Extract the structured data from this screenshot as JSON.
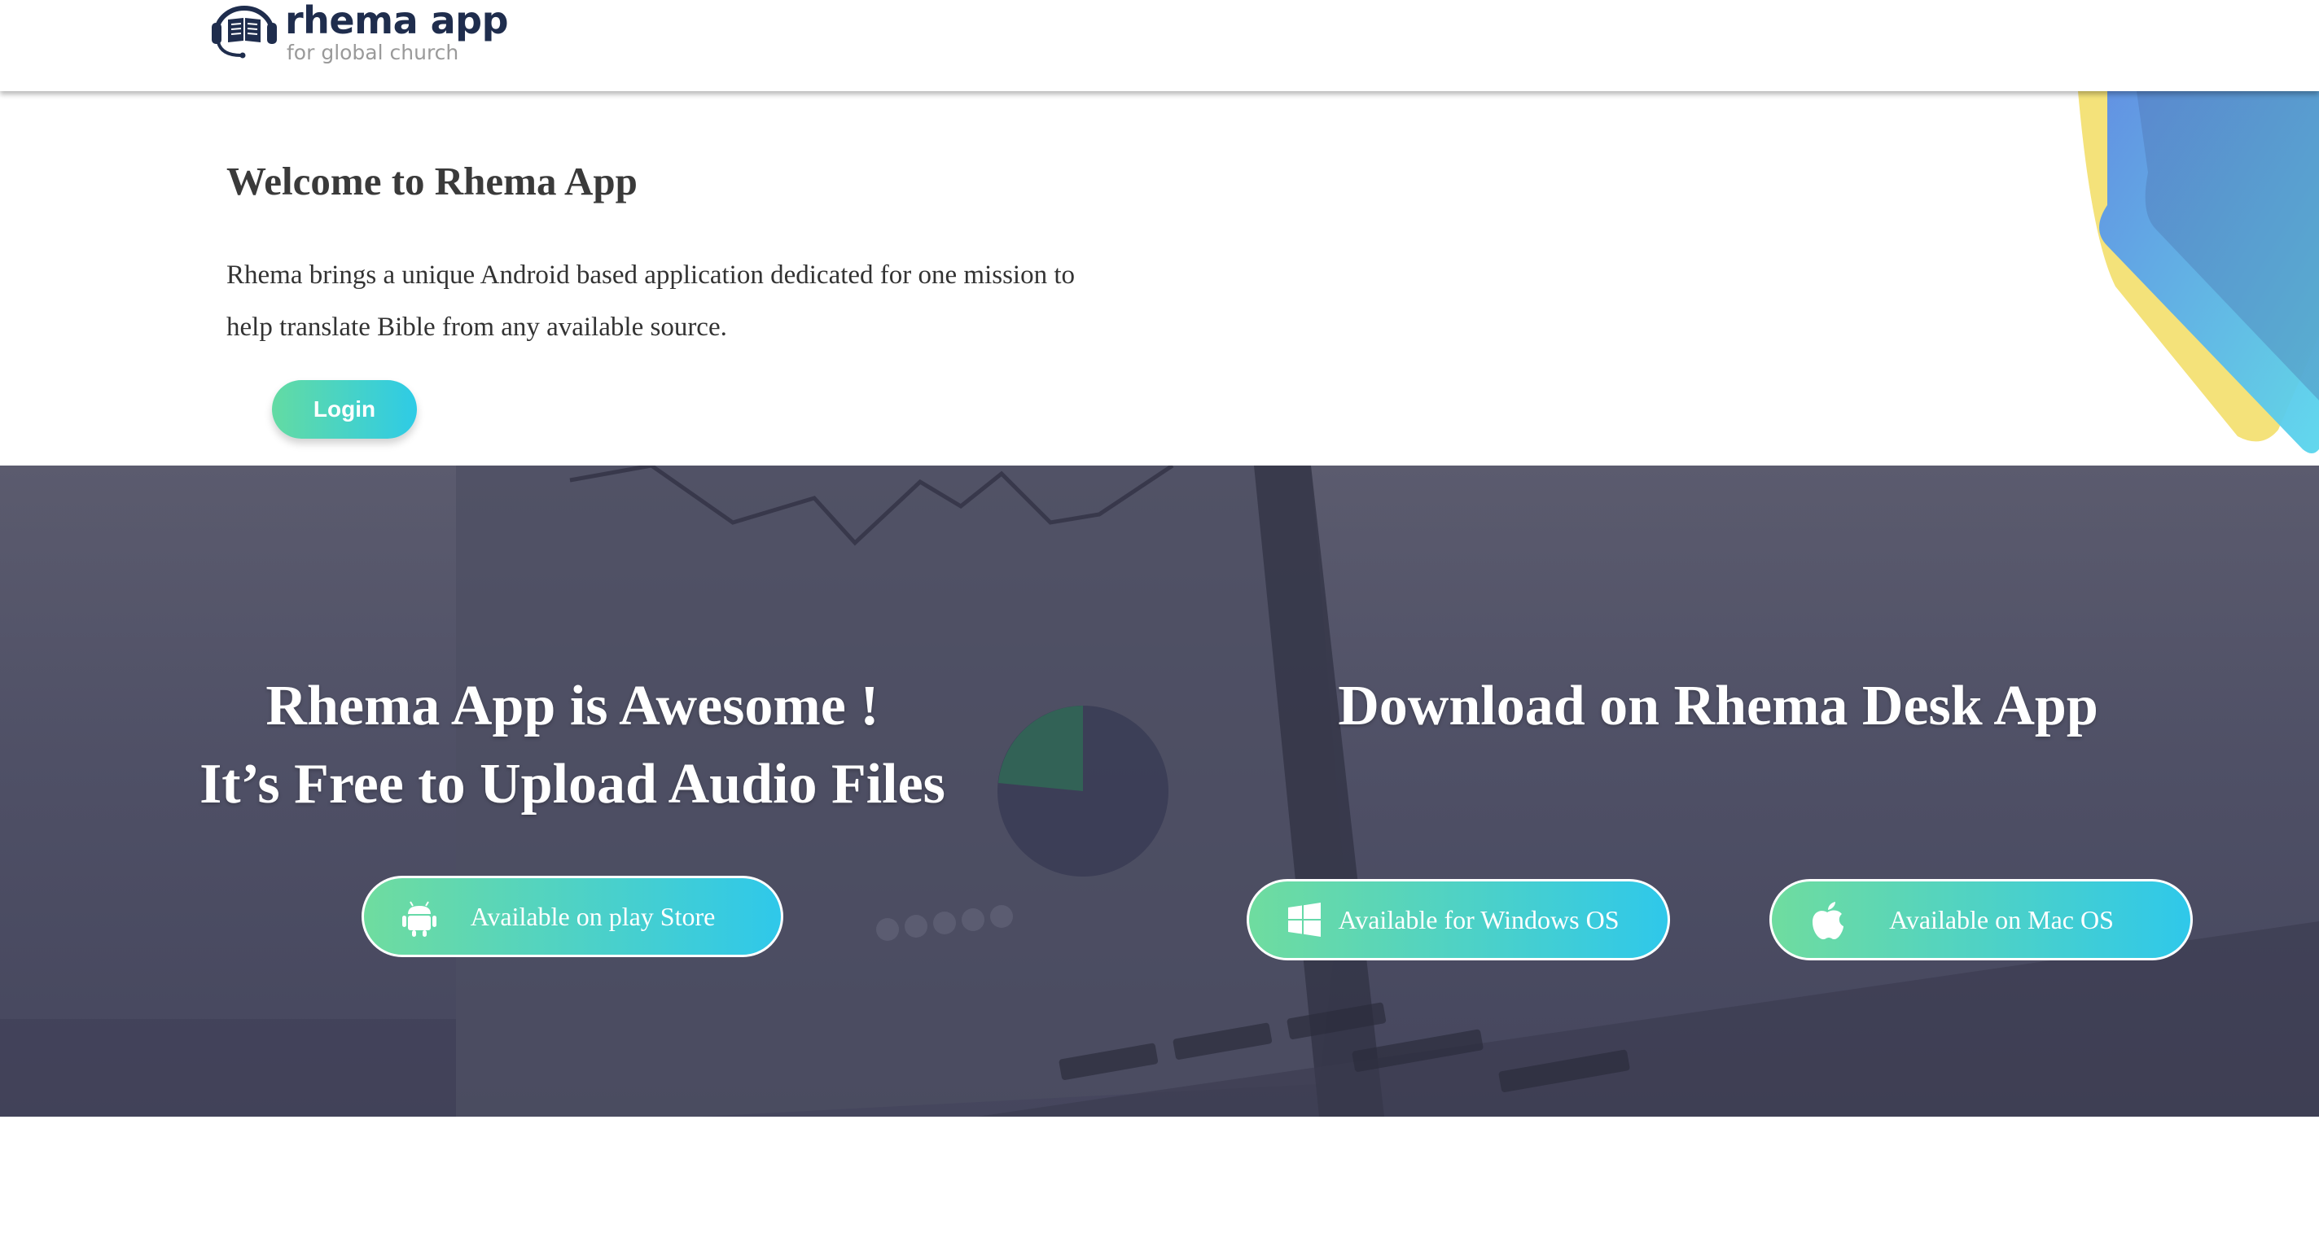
{
  "header": {
    "logo_name": "rhema app",
    "logo_tagline": "for global church",
    "logo_icon": "bible-headset-icon"
  },
  "welcome": {
    "title": "Welcome to Rhema App",
    "description": "Rhema brings a unique Android based application dedicated for one mission to help translate Bible from any available source.",
    "login_label": "Login"
  },
  "hero": {
    "left_line1": "Rhema App is Awesome !",
    "left_line2": "It’s Free to Upload Audio Files",
    "right_title": "Download on Rhema Desk App",
    "buttons": {
      "play_store": {
        "label": "Available on play Store",
        "icon": "android-icon"
      },
      "windows": {
        "label": "Available for Windows OS",
        "icon": "windows-icon"
      },
      "mac": {
        "label": "Available on Mac OS",
        "icon": "apple-icon"
      }
    }
  },
  "colors": {
    "brand_navy": "#1f2d4d",
    "button_gradient_start": "#63dba3",
    "button_gradient_end": "#2ecbe6",
    "hero_overlay": "#4f5066"
  }
}
